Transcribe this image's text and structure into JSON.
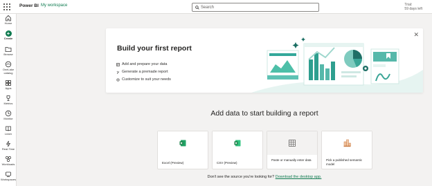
{
  "header": {
    "brand": "Power BI",
    "workspace": "My workspace",
    "search_placeholder": "Search",
    "trial_line1": "Trial:",
    "trial_line2": "59 days left"
  },
  "nav": {
    "items": [
      {
        "label": "Home",
        "icon": "home-icon"
      },
      {
        "label": "Create",
        "icon": "plus-circle-icon"
      },
      {
        "label": "Browse",
        "icon": "folder-icon"
      },
      {
        "label": "OneLake",
        "label2": "catalog",
        "icon": "onelake-icon"
      },
      {
        "label": "Apps",
        "icon": "apps-icon"
      },
      {
        "label": "Metrics",
        "icon": "trophy-icon"
      },
      {
        "label": "Monitor",
        "icon": "monitor-icon"
      },
      {
        "label": "Learn",
        "icon": "book-icon"
      },
      {
        "label": "Real-Time",
        "icon": "lightning-icon"
      },
      {
        "label": "Workloads",
        "icon": "workloads-icon"
      },
      {
        "label": "Workspaces",
        "icon": "workspaces-icon"
      }
    ]
  },
  "hero": {
    "title": "Build your first report",
    "items": [
      "Add and prepare your data",
      "Generate a premade report",
      "Customize to suit your needs"
    ]
  },
  "section_title": "Add data to start building a report",
  "tiles": [
    {
      "label": "Excel (Preview)",
      "icon": "excel-icon"
    },
    {
      "label": "CSV (Preview)",
      "icon": "csv-icon"
    },
    {
      "label": "Paste or manually enter data",
      "icon": "table-icon"
    },
    {
      "label": "Pick a published semantic model",
      "icon": "semantic-model-icon"
    }
  ],
  "footer": {
    "text": "Don't see the source you're looking for?",
    "link": "Download the desktop app."
  },
  "colors": {
    "accent": "#0e7a4f",
    "teal": "#33a89a",
    "background": "#f3f2f1"
  }
}
